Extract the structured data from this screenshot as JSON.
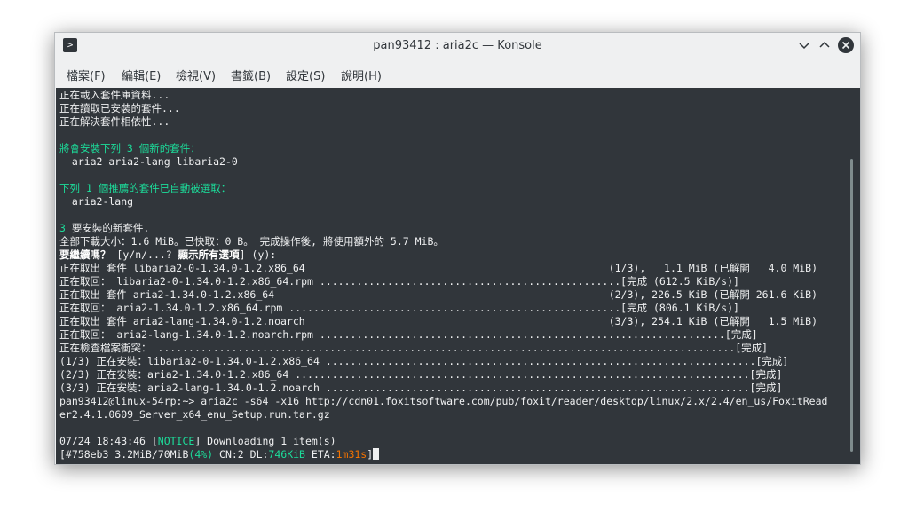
{
  "window": {
    "title": "pan93412 : aria2c — Konsole"
  },
  "menu": [
    {
      "label": "檔案(F)"
    },
    {
      "label": "編輯(E)"
    },
    {
      "label": "檢視(V)"
    },
    {
      "label": "書籤(B)"
    },
    {
      "label": "設定(S)"
    },
    {
      "label": "說明(H)"
    }
  ],
  "lines": {
    "l1": "正在載入套件庫資料...",
    "l2": "正在讀取已安裝的套件...",
    "l3": "正在解決套件相依性...",
    "l5": "將會安裝下列 3 個新的套件：",
    "l6": "  aria2 aria2-lang libaria2-0",
    "l8": "下列 1 個推薦的套件已自動被選取：",
    "l9": "  aria2-lang",
    "l11a": "3",
    "l11b": " 要安裝的新套件.",
    "l12": "全部下載大小：1.6 MiB。已快取：0 B。 完成操作後, 將使用額外的 5.7 MiB。",
    "l13a": "要繼續嗎？",
    "l13b": " [y/n/...? ",
    "l13c": "顯示所有選項",
    "l13d": "] (y):",
    "l14": "正在取出 套件 libaria2-0-1.34.0-1.2.x86_64",
    "l14r": "(1/3),   1.1 MiB (已解開   4.0 MiB)",
    "l15": "正在取回： libaria2-0-1.34.0-1.2.x86_64.rpm .................................................[完成 (612.5 KiB/s)]",
    "l16": "正在取出 套件 aria2-1.34.0-1.2.x86_64",
    "l16r": "(2/3), 226.5 KiB (已解開 261.6 KiB)",
    "l17": "正在取回： aria2-1.34.0-1.2.x86_64.rpm ......................................................[完成 (806.1 KiB/s)]",
    "l18": "正在取出 套件 aria2-lang-1.34.0-1.2.noarch",
    "l18r": "(3/3), 254.1 KiB (已解開   1.5 MiB)",
    "l19": "正在取回： aria2-lang-1.34.0-1.2.noarch.rpm ..................................................................[完成]",
    "l20": "正在檢查檔案衝突： ..............................................................................................[完成]",
    "l21": "(1/3) 正在安裝：libaria2-0-1.34.0-1.2.x86_64 ......................................................................[完成]",
    "l22": "(2/3) 正在安裝：aria2-1.34.0-1.2.x86_64 ..........................................................................[完成]",
    "l23": "(3/3) 正在安裝：aria2-lang-1.34.0-1.2.noarch .....................................................................[完成]",
    "l24": "pan93412@linux-54rp:~> aria2c -s64 -x16 http://cdn01.foxitsoftware.com/pub/foxit/reader/desktop/linux/2.x/2.4/en_us/FoxitRead",
    "l25": "er2.4.1.0609_Server_x64_enu_Setup.run.tar.gz",
    "l27a": "07/24 18:43:46 [",
    "l27b": "NOTICE",
    "l27c": "] Downloading 1 item(s)",
    "l28a": "[#758eb3 3.2MiB/70MiB",
    "l28b": "(4%)",
    "l28c": " CN:2 DL:",
    "l28d": "746KiB",
    "l28e": " ETA:",
    "l28f": "1m31s",
    "l28g": "]"
  },
  "colors": {
    "terminal_bg": "#31363b",
    "green": "#1cdc9a",
    "orange": "#f67400"
  }
}
